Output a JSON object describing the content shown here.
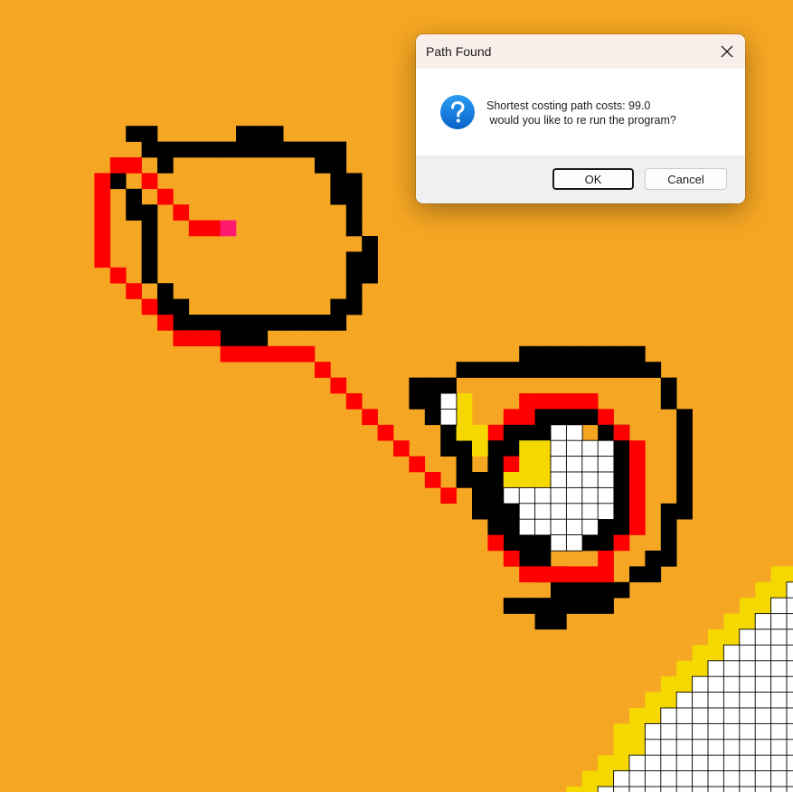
{
  "canvas": {
    "background": "#f5a623",
    "colors": {
      "wall": "#000000",
      "path": "#ff0000",
      "target": "#ff1a6e",
      "border": "#f5d800",
      "open": "#ffffff"
    }
  },
  "dialog": {
    "title": "Path Found",
    "message": "Shortest costing path costs: 99.0\n would you like to re run the program?",
    "ok_label": "OK",
    "cancel_label": "Cancel",
    "icon": "question-icon",
    "close_icon": "close-icon"
  }
}
